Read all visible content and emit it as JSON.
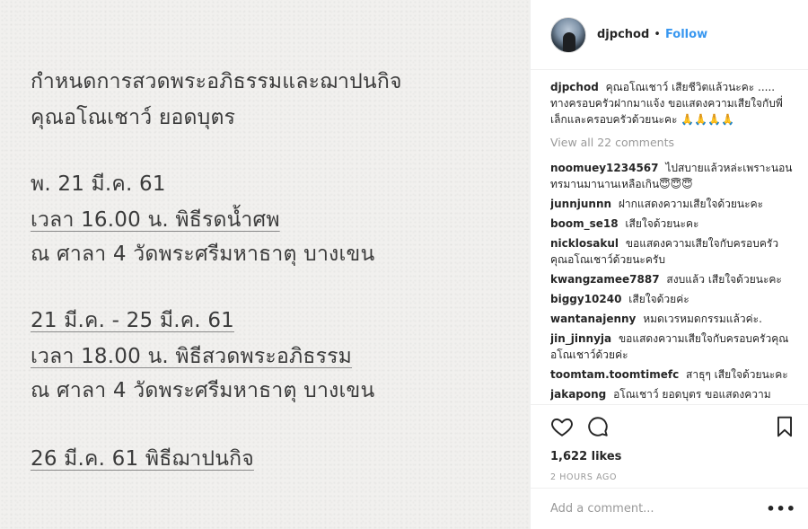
{
  "photo": {
    "lines": [
      "กำหนดการสวดพระอภิธรรมและฌาปนกิจ",
      "คุณอโณเชาว์ ยอดบุตร",
      "พ. 21 มี.ค. 61",
      "เวลา 16.00 น. พิธีรดน้ำศพ",
      "ณ ศาลา 4 วัดพระศรีมหาธาตุ บางเขน",
      "21 มี.ค. - 25 มี.ค. 61",
      "เวลา 18.00 น. พิธีสวดพระอภิธรรม",
      "ณ ศาลา 4 วัดพระศรีมหาธาตุ บางเขน",
      "26 มี.ค. 61 พิธีฌาปนกิจ"
    ]
  },
  "header": {
    "username": "djpchod",
    "separator": "•",
    "follow_label": "Follow"
  },
  "caption": {
    "user": "djpchod",
    "text": "คุณอโณเชาว์ เสียชีวิตแล้วนะคะ ..... ทางครอบครัวฝากมาแจ้ง ขอแสดงความเสียใจกับพี่เล็กและครอบครัวด้วยนะคะ 🙏🙏🙏🙏"
  },
  "view_all": "View all 22 comments",
  "comments": [
    {
      "user": "noomuey1234567",
      "text": "ไปสบายแล้วหล่ะเพราะนอนทรมานมานานเหลือเกิน😇😇😇"
    },
    {
      "user": "junnjunnn",
      "text": "ฝากแสดงความเสียใจด้วยนะคะ"
    },
    {
      "user": "boom_se18",
      "text": "เสียใจด้วยนะคะ"
    },
    {
      "user": "nicklosakul",
      "text": "ขอแสดงความเสียใจกับครอบครัวคุณอโณเชาว์ด้วยนะครับ"
    },
    {
      "user": "kwangzamee7887",
      "text": "สงบแล้ว เสียใจด้วยนะคะ"
    },
    {
      "user": "biggy10240",
      "text": "เสียใจด้วยค่ะ"
    },
    {
      "user": "wantanajenny",
      "text": "หมดเวรหมดกรรมแล้วค่ะ."
    },
    {
      "user": "jin_jinnyja",
      "text": "ขอแสดงความเสียใจกับครอบครัวคุณอโณเชาว์ด้วยค่ะ"
    },
    {
      "user": "toomtam.toomtimefc",
      "text": "สาธุๆ เสียใจด้วยนะคะ"
    },
    {
      "user": "jakapong",
      "text": "อโณเชาว์ ยอดบุตร ขอแสดงความ"
    }
  ],
  "actions": {
    "like_icon": "heart-icon",
    "comment_icon": "comment-icon",
    "save_icon": "bookmark-icon"
  },
  "likes": "1,622 likes",
  "time": "2 HOURS AGO",
  "add_comment": {
    "placeholder": "Add a comment...",
    "more_label": "•••"
  },
  "colors": {
    "accent": "#3897f0",
    "muted": "#999999",
    "photo_bg": "#f1f0ee"
  }
}
